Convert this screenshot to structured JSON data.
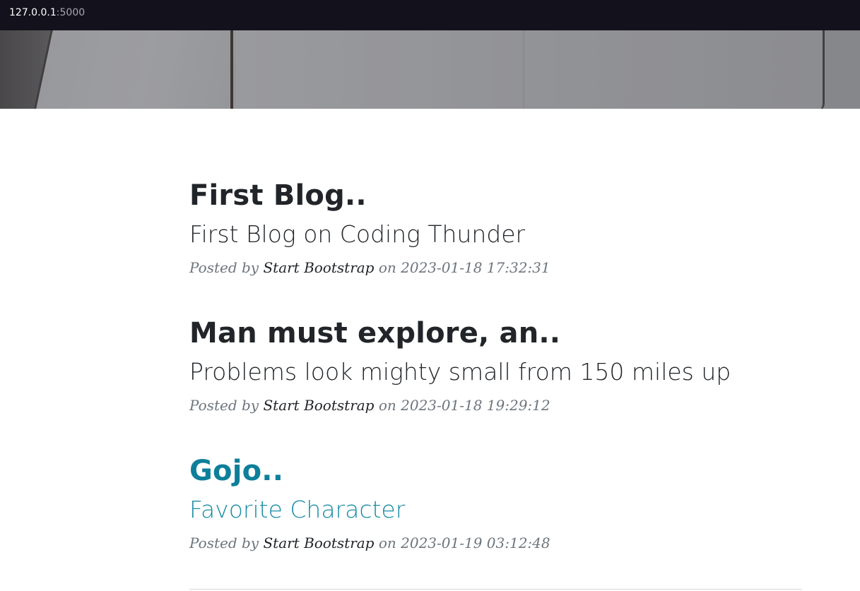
{
  "address_bar": {
    "host": "127.0.0.1",
    "port": ":5000"
  },
  "posts": [
    {
      "title": "First Blog..",
      "subtitle": "First Blog on Coding Thunder",
      "meta_prefix": "Posted by ",
      "author": "Start Bootstrap",
      "meta_on": " on ",
      "date": "2023-01-18 17:32:31"
    },
    {
      "title": "Man must explore, an..",
      "subtitle": "Problems look mighty small from 150 miles up",
      "meta_prefix": "Posted by ",
      "author": "Start Bootstrap",
      "meta_on": " on ",
      "date": "2023-01-18 19:29:12"
    },
    {
      "title": "Gojo..",
      "subtitle": "Favorite Character",
      "meta_prefix": "Posted by ",
      "author": "Start Bootstrap",
      "meta_on": " on ",
      "date": "2023-01-19 03:12:48",
      "state": "hover"
    }
  ],
  "colors": {
    "title": "#212529",
    "hover_link": "#0d7f9a",
    "meta": "#6c757d",
    "topbar": "#13121c"
  }
}
